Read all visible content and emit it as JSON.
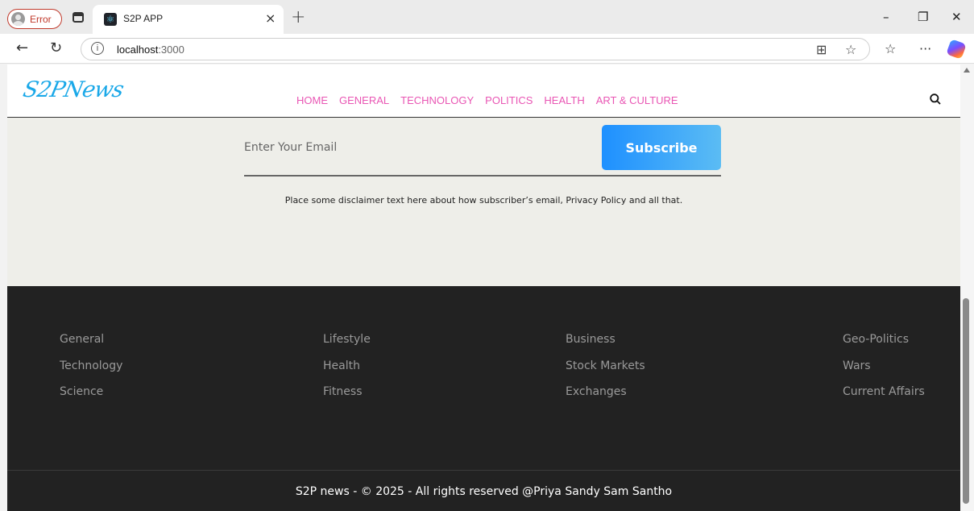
{
  "browser": {
    "profile_label": "Error",
    "tab_title": "S2P APP",
    "tab_close": "×",
    "new_tab": "+",
    "url_host": "localhost",
    "url_port": ":3000",
    "controls": {
      "minimize": "–",
      "restore": "❐",
      "close": "✕"
    }
  },
  "site": {
    "logo": "S2PNews",
    "nav": [
      "HOME",
      "GENERAL",
      "TECHNOLOGY",
      "POLITICS",
      "HEALTH",
      "ART & CULTURE"
    ],
    "accent_color": "#e956b4",
    "logo_color": "#1aa8e8"
  },
  "newsletter": {
    "email_placeholder": "Enter Your Email",
    "subscribe_label": "Subscribe",
    "disclaimer": "Place some disclaimer text here about how subscriber’s email, Privacy Policy and all that."
  },
  "footer": {
    "columns": [
      [
        "General",
        "Technology",
        "Science"
      ],
      [
        "Lifestyle",
        "Health",
        "Fitness"
      ],
      [
        "Business",
        "Stock Markets",
        "Exchanges"
      ],
      [
        "Geo-Politics",
        "Wars",
        "Current Affairs"
      ]
    ],
    "copyright": "S2P news - © 2025 - All rights reserved @Priya Sandy Sam Santho"
  }
}
